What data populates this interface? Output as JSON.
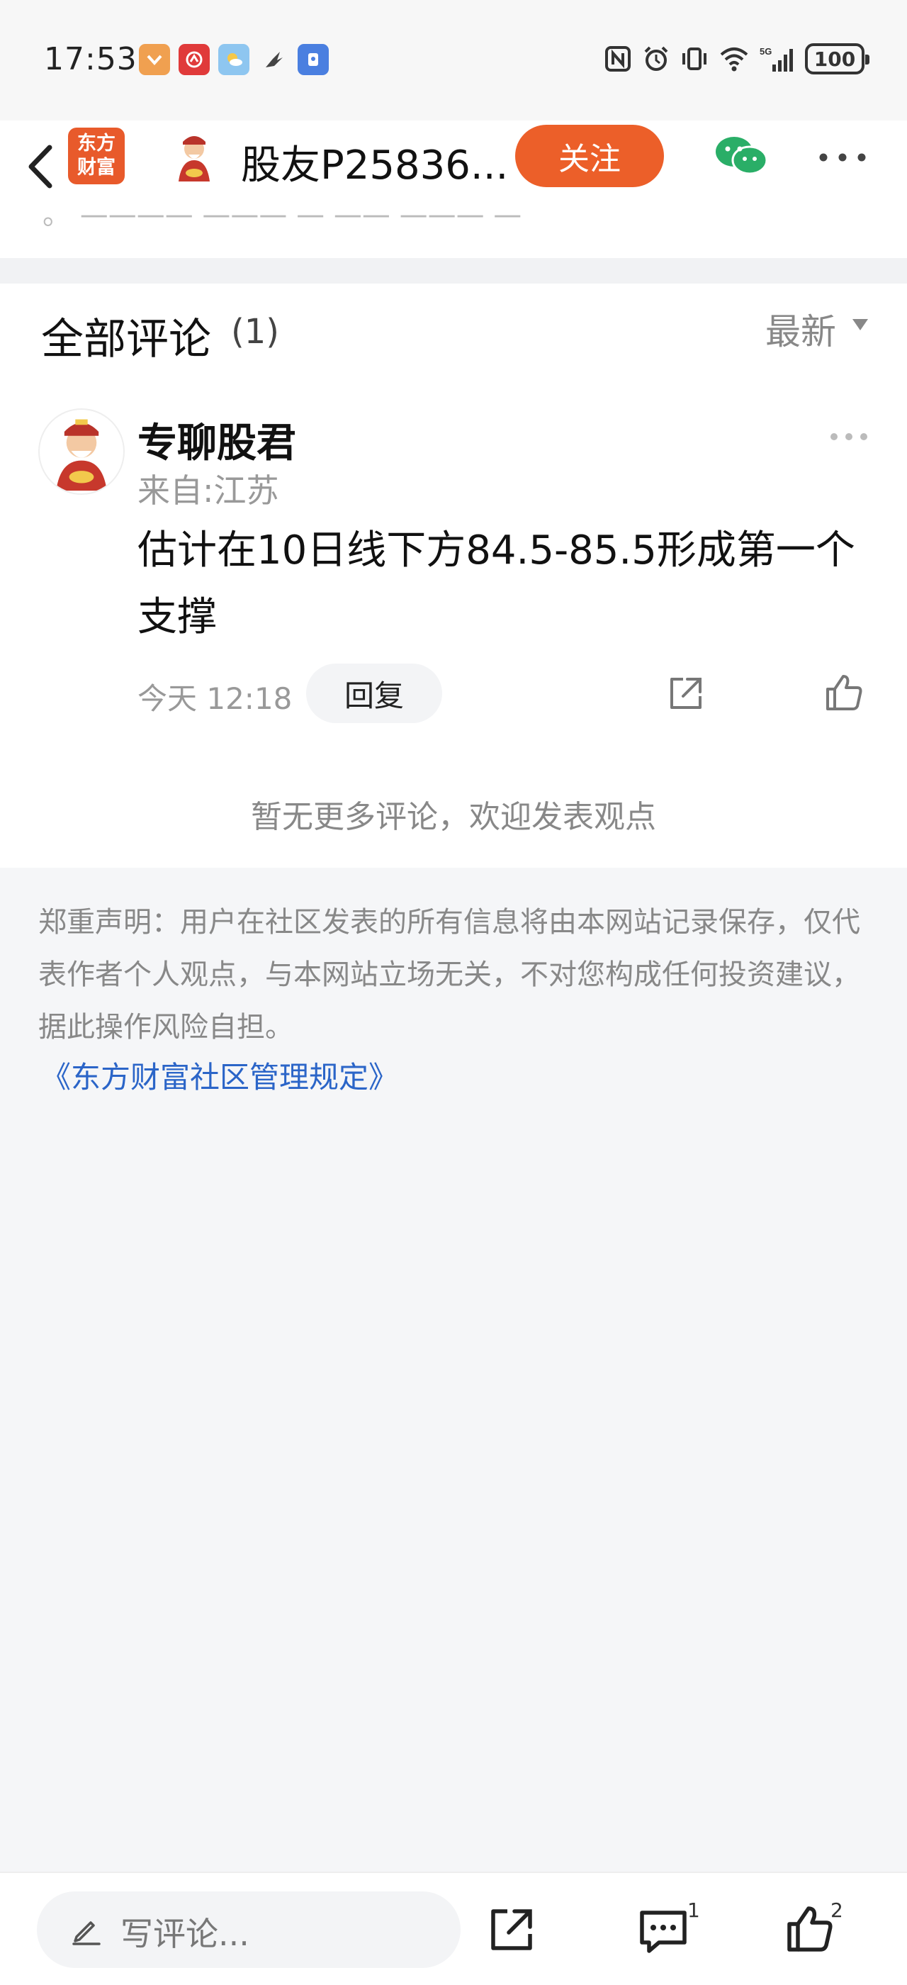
{
  "status_bar": {
    "time": "17:53",
    "battery": "100",
    "network": "5G"
  },
  "header": {
    "logo_text_line1": "东方",
    "logo_text_line2": "财富",
    "title": "股友P25836...",
    "follow_label": "关注"
  },
  "strip": {
    "partial_text": "。 ———— ——— — —— ——— —"
  },
  "comments": {
    "title": "全部评论",
    "count": "(1)",
    "sort_label": "最新",
    "items": [
      {
        "author": "专聊股君",
        "location": "来自:江苏",
        "text": "估计在10日线下方84.5-85.5形成第一个支撑",
        "time": "今天 12:18",
        "reply_label": "回复"
      }
    ],
    "no_more": "暂无更多评论，欢迎发表观点"
  },
  "disclaimer": {
    "text": "郑重声明：用户在社区发表的所有信息将由本网站记录保存，仅代表作者个人观点，与本网站立场无关，不对您构成任何投资建议，据此操作风险自担。",
    "link": "《东方财富社区管理规定》"
  },
  "bottom_bar": {
    "input_placeholder": "写评论...",
    "comment_count": "1",
    "like_count": "2"
  },
  "colors": {
    "accent": "#ec5f29",
    "link": "#2b65c8",
    "wechat": "#2aae67"
  }
}
